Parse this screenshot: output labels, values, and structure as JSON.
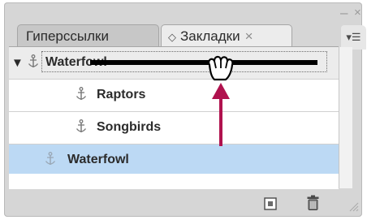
{
  "window": {
    "minimize_glyph": "–",
    "close_glyph": "×"
  },
  "tabs": [
    {
      "label": "Гиперссылки",
      "active": false
    },
    {
      "label": "Закладки",
      "active": true,
      "icon": "diamond-icon",
      "close_glyph": "×"
    }
  ],
  "panel_menu_glyph": "▾☰",
  "bookmarks": [
    {
      "label": "Waterfowl",
      "state": "dragging",
      "expanded": true,
      "icon": "anchor-icon"
    },
    {
      "label": "Raptors",
      "icon": "anchor-icon"
    },
    {
      "label": "Songbirds",
      "icon": "anchor-icon"
    },
    {
      "label": "Waterfowl",
      "state": "selected",
      "icon": "anchor-icon"
    }
  ],
  "overlay": {
    "cursor": "grab-hand-icon",
    "arrow": "up-arrow-icon",
    "arrow_color": "#b0124e"
  },
  "footer": {
    "icons": [
      "new-bookmark-icon",
      "trash-icon",
      "resize-grip-icon"
    ]
  },
  "colors": {
    "panel": "#d6d6d6",
    "selection": "#bcd9f4",
    "active_tab": "#ececec"
  }
}
